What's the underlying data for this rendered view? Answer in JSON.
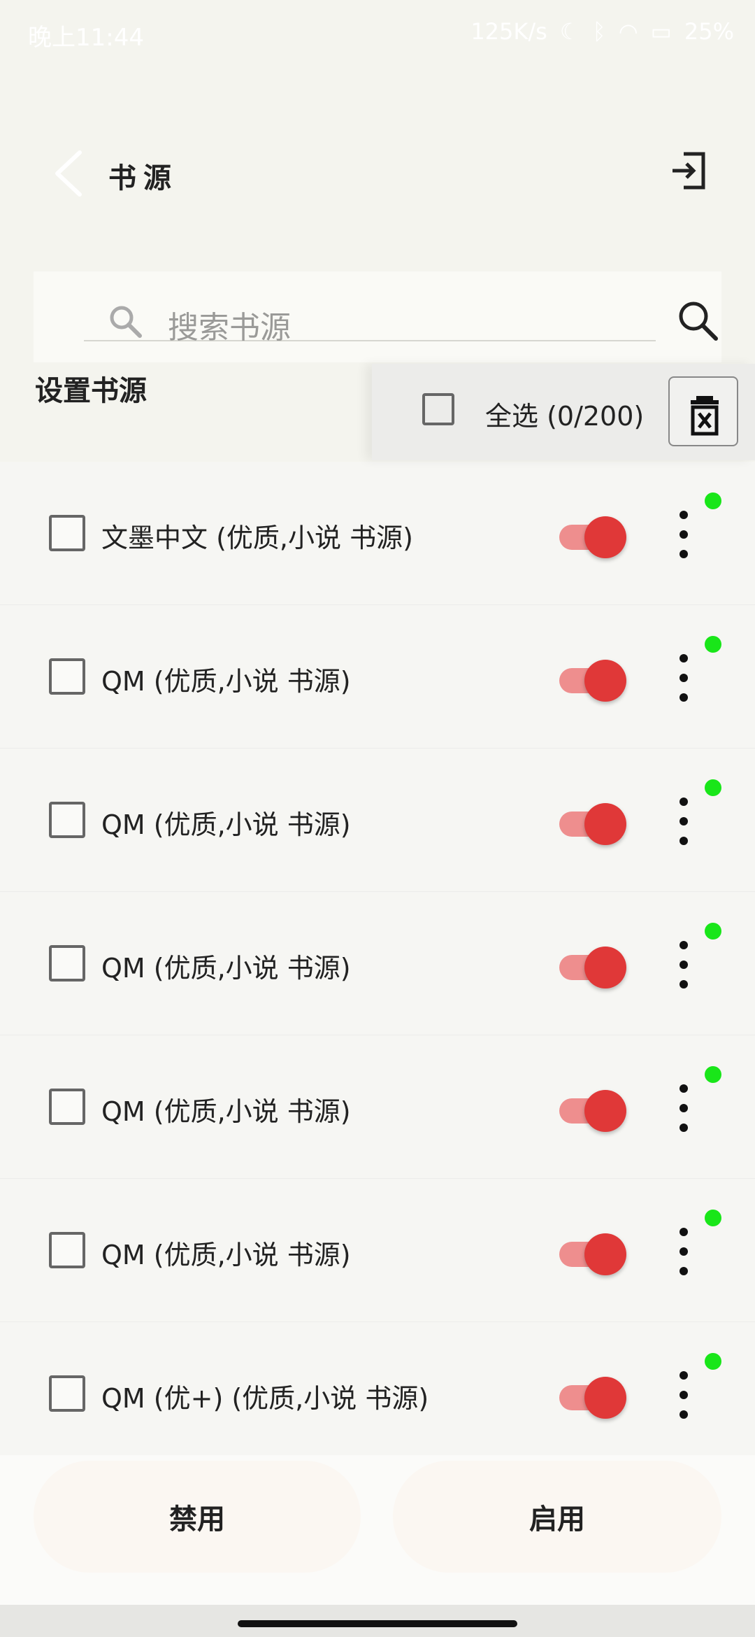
{
  "status_bar": {
    "time": "晚上11:44",
    "net_speed": "125K/s",
    "battery": "25%"
  },
  "header": {
    "title": "书源"
  },
  "search": {
    "placeholder": "搜索书源"
  },
  "settings": {
    "label": "设置书源",
    "select_all_label": "全选 (0/200)"
  },
  "sources": [
    {
      "name": "文墨中文 (优质,小说 书源)",
      "checked": false,
      "enabled": true
    },
    {
      "name": "QM (优质,小说 书源)",
      "checked": false,
      "enabled": true
    },
    {
      "name": "QM (优质,小说 书源)",
      "checked": false,
      "enabled": true
    },
    {
      "name": "QM (优质,小说 书源)",
      "checked": false,
      "enabled": true
    },
    {
      "name": "QM (优质,小说 书源)",
      "checked": false,
      "enabled": true
    },
    {
      "name": "QM (优质,小说 书源)",
      "checked": false,
      "enabled": true
    },
    {
      "name": "QM (优+) (优质,小说 书源)",
      "checked": false,
      "enabled": true
    }
  ],
  "actions": {
    "disable_label": "禁用",
    "enable_label": "启用"
  },
  "colors": {
    "accent": "#e03838",
    "switch_track": "#ee8e8e",
    "status_dot": "#19e619"
  }
}
